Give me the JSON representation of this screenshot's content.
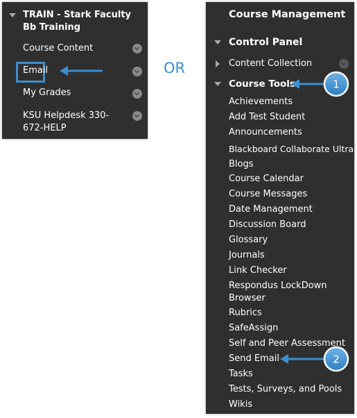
{
  "left_panel": {
    "course_title": "TRAIN - Stark Faculty Bb Training",
    "menu_items": [
      {
        "label": "Course Content"
      },
      {
        "label": "Email"
      },
      {
        "label": "My Grades"
      },
      {
        "label": "KSU Helpdesk 330-672-HELP"
      }
    ]
  },
  "or_label": "OR",
  "right_panel": {
    "title": "Course Management",
    "control_panel": "Control Panel",
    "content_collection": "Content Collection",
    "course_tools": "Course Tools",
    "tools": [
      "Achievements",
      "Add Test Student",
      "Announcements",
      "Blackboard Collaborate Ultra",
      "Blogs",
      "Course Calendar",
      "Course Messages",
      "Date Management",
      "Discussion Board",
      "Glossary",
      "Journals",
      "Link Checker",
      "Respondus LockDown Browser",
      "Rubrics",
      "SafeAssign",
      "Self and Peer Assessment",
      "Send Email",
      "Tasks",
      "Tests, Surveys, and Pools",
      "Wikis"
    ]
  },
  "callouts": {
    "step1": "1",
    "step2": "2"
  },
  "colors": {
    "panel_bg": "#2f2f2f",
    "accent_blue": "#3b8fd0"
  }
}
